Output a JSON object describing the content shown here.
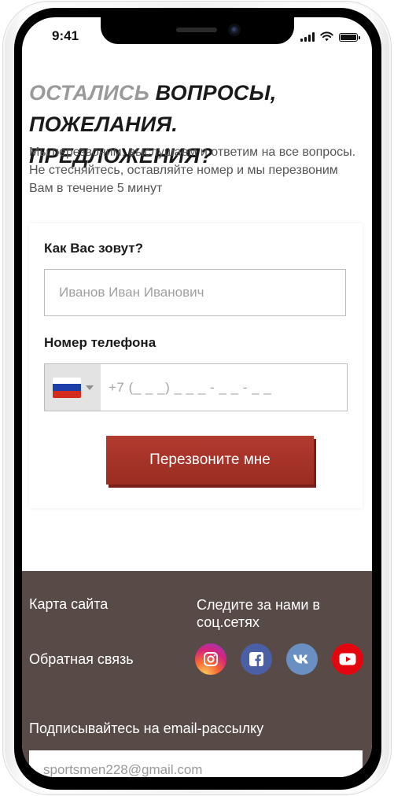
{
  "status_bar": {
    "time": "9:41"
  },
  "heading": {
    "accent": "ОСТАЛИСЬ",
    "main_line1": " ВОПРОСЫ,",
    "main_line2": "ПОЖЕЛАНИЯ. ПРЕДЛОЖЕНИЯ?"
  },
  "subtitle": "Мы перезвоним, выслушаем и ответим на все вопросы. Не стесняйтесь, оставляйте номер и мы перезвоним Вам в течение 5 минут",
  "form": {
    "name_label": "Как Вас зовут?",
    "name_placeholder": "Иванов Иван Иванович",
    "phone_label": "Номер телефона",
    "phone_placeholder": "+7 (_ _ _) _ _ _ - _ _ - _ _",
    "country_flag_colors": [
      "#ffffff",
      "#1c3fa8",
      "#d52b1e"
    ],
    "submit_label": "Перезвоните мне",
    "accent_color": "#a3322a"
  },
  "footer": {
    "sitemap": "Карта сайта",
    "feedback": "Обратная связь",
    "follow_us": "Следите за нами в соц.сетях",
    "social_icons": [
      "instagram-icon",
      "facebook-icon",
      "vk-icon",
      "youtube-icon"
    ],
    "subscribe_label": "Подписывайтесь на email-рассылку",
    "email_value": "sportsmen228@gmail.com",
    "background_color": "#584a47"
  }
}
